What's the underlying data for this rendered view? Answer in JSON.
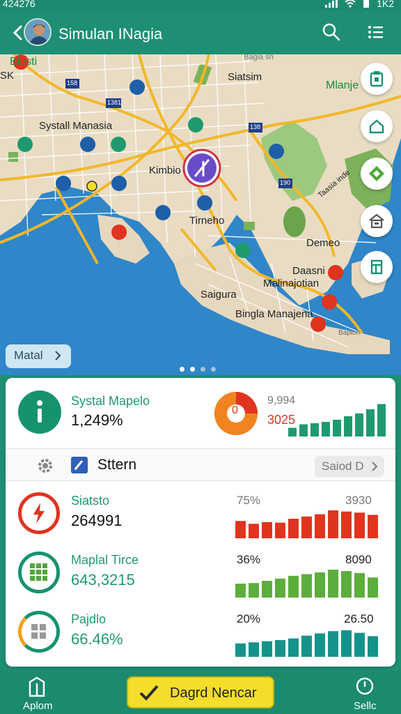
{
  "status_bar": {
    "time": "424276",
    "battery": "1K2"
  },
  "header": {
    "title": "Simulan INagia"
  },
  "map": {
    "labels": [
      "Blesti",
      "SK",
      "Siatsim",
      "Mlanje",
      "Systall Manasia",
      "Kimbio",
      "Tirneho",
      "Demeo",
      "Daasni",
      "Malinajotian",
      "Saigura",
      "Bingla Manajena",
      "Taasia inde",
      "Bapion",
      "Bagia sh"
    ],
    "road_badges": [
      "158",
      "1381",
      "138",
      "190"
    ],
    "chip_label": "Matal"
  },
  "summary": {
    "label": "Systal Mapelo",
    "value": "1,249%",
    "ring_value": "0",
    "stat_top": "9,994",
    "stat_bottom": "3025",
    "bars": [
      0.25,
      0.35,
      0.38,
      0.42,
      0.48,
      0.58,
      0.66,
      0.78,
      0.93
    ]
  },
  "tab": {
    "label": "Sttern",
    "sort_label": "Saiod D"
  },
  "metrics": [
    {
      "label": "Siatsto",
      "value": "264991",
      "pct": "75%",
      "count": "3930",
      "color": "#e0341f",
      "bars": [
        0.62,
        0.52,
        0.58,
        0.56,
        0.7,
        0.78,
        0.86,
        1.0,
        0.96,
        0.92,
        0.84
      ]
    },
    {
      "label": "Maplal Tirce",
      "value": "643,3215",
      "pct": "36%",
      "count": "8090",
      "color": "#5cae3c",
      "bars": [
        0.5,
        0.52,
        0.6,
        0.68,
        0.78,
        0.84,
        0.9,
        1.0,
        0.95,
        0.88,
        0.72
      ]
    },
    {
      "label": "Pajdlo",
      "value": "66.46%",
      "pct": "20%",
      "count": "26.50",
      "color": "#15938a",
      "bars": [
        0.48,
        0.52,
        0.56,
        0.6,
        0.66,
        0.76,
        0.84,
        0.92,
        0.95,
        0.86,
        0.74
      ]
    }
  ],
  "bottom_nav": {
    "left": "Aplom",
    "cta": "Dagrd Nencar",
    "right": "Sellc"
  },
  "colors": {
    "header": "#1e8f74",
    "accent_green": "#1e9a6e",
    "red": "#e0341f",
    "water": "#2f86c8",
    "land": "#e9dcc3",
    "park": "#7bb25a"
  }
}
